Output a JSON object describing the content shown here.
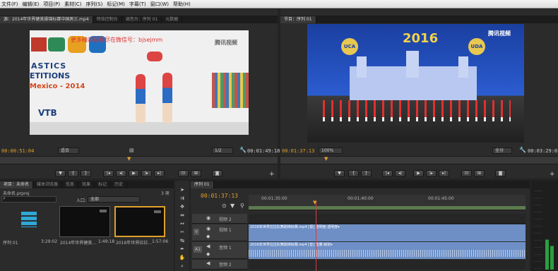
{
  "menu": [
    "文件(F)",
    "编辑(E)",
    "项目(P)",
    "素材(C)",
    "序列(S)",
    "标记(M)",
    "字幕(T)",
    "窗口(W)",
    "帮助(H)"
  ],
  "source": {
    "tabs": [
      "源：2014年世界健美操锦标赛中国男三.mp4",
      "特效控制台",
      "调音台：序列 01",
      "元数据"
    ],
    "overlay_text": "更多精彩视频尽在微信号：bjsejmm",
    "logo": "腾讯视频",
    "banner": [
      "ASTICS",
      "ETITIONS",
      "Mexico - 2014",
      "VTB"
    ],
    "tc_current": "00:00:51:04",
    "fit": "适合",
    "resolution": "1/2",
    "tc_duration": "00:01:49:18"
  },
  "program": {
    "tab": "节目：序列 01",
    "logo": "腾讯视频",
    "year": "2016",
    "badges": [
      "UCA",
      "UDA"
    ],
    "tc_current": "00:01:37:13",
    "zoom": "100%",
    "quality": "全分",
    "tc_duration": "00:03:29:02"
  },
  "project": {
    "tabs": [
      "项目：未命名",
      "媒体浏览器",
      "信息",
      "效果",
      "标记",
      "历史"
    ],
    "name": "未命名.prproj",
    "count": "3 项",
    "entry_label": "入口:",
    "entry_value": "全部",
    "items": [
      {
        "name": "序列 01",
        "duration": "3:29:02"
      },
      {
        "name": "2014年世界健美...",
        "duration": "1:49:18"
      },
      {
        "name": "2016年世界拉拉...",
        "duration": "1:57:06"
      }
    ]
  },
  "timeline": {
    "tab": "序列 01",
    "tc": "00:01:37:13",
    "ruler": [
      "00:01:35:00",
      "00:01:40:00",
      "00:01:45:00"
    ],
    "tracks": [
      {
        "id": "v2",
        "label": "视频 2"
      },
      {
        "id": "v1",
        "label": "视频 1",
        "side": "V"
      },
      {
        "id": "a1",
        "label": "音频 1",
        "side": "A1"
      },
      {
        "id": "a2",
        "label": "音频 2"
      }
    ],
    "video_clip": "2016年世界拉拉队舞蹈锦标赛.mp4 [视] 透明度:透明度▾",
    "audio_clip": "2016年世界拉拉队舞蹈锦标赛.mp4 [音] 音量:级别▾"
  },
  "colors": {
    "timecode": "#e0a02a",
    "playhead": "#e03a3a",
    "video_clip": "#8fa8d8",
    "audio_clip": "#8fa8d8"
  }
}
